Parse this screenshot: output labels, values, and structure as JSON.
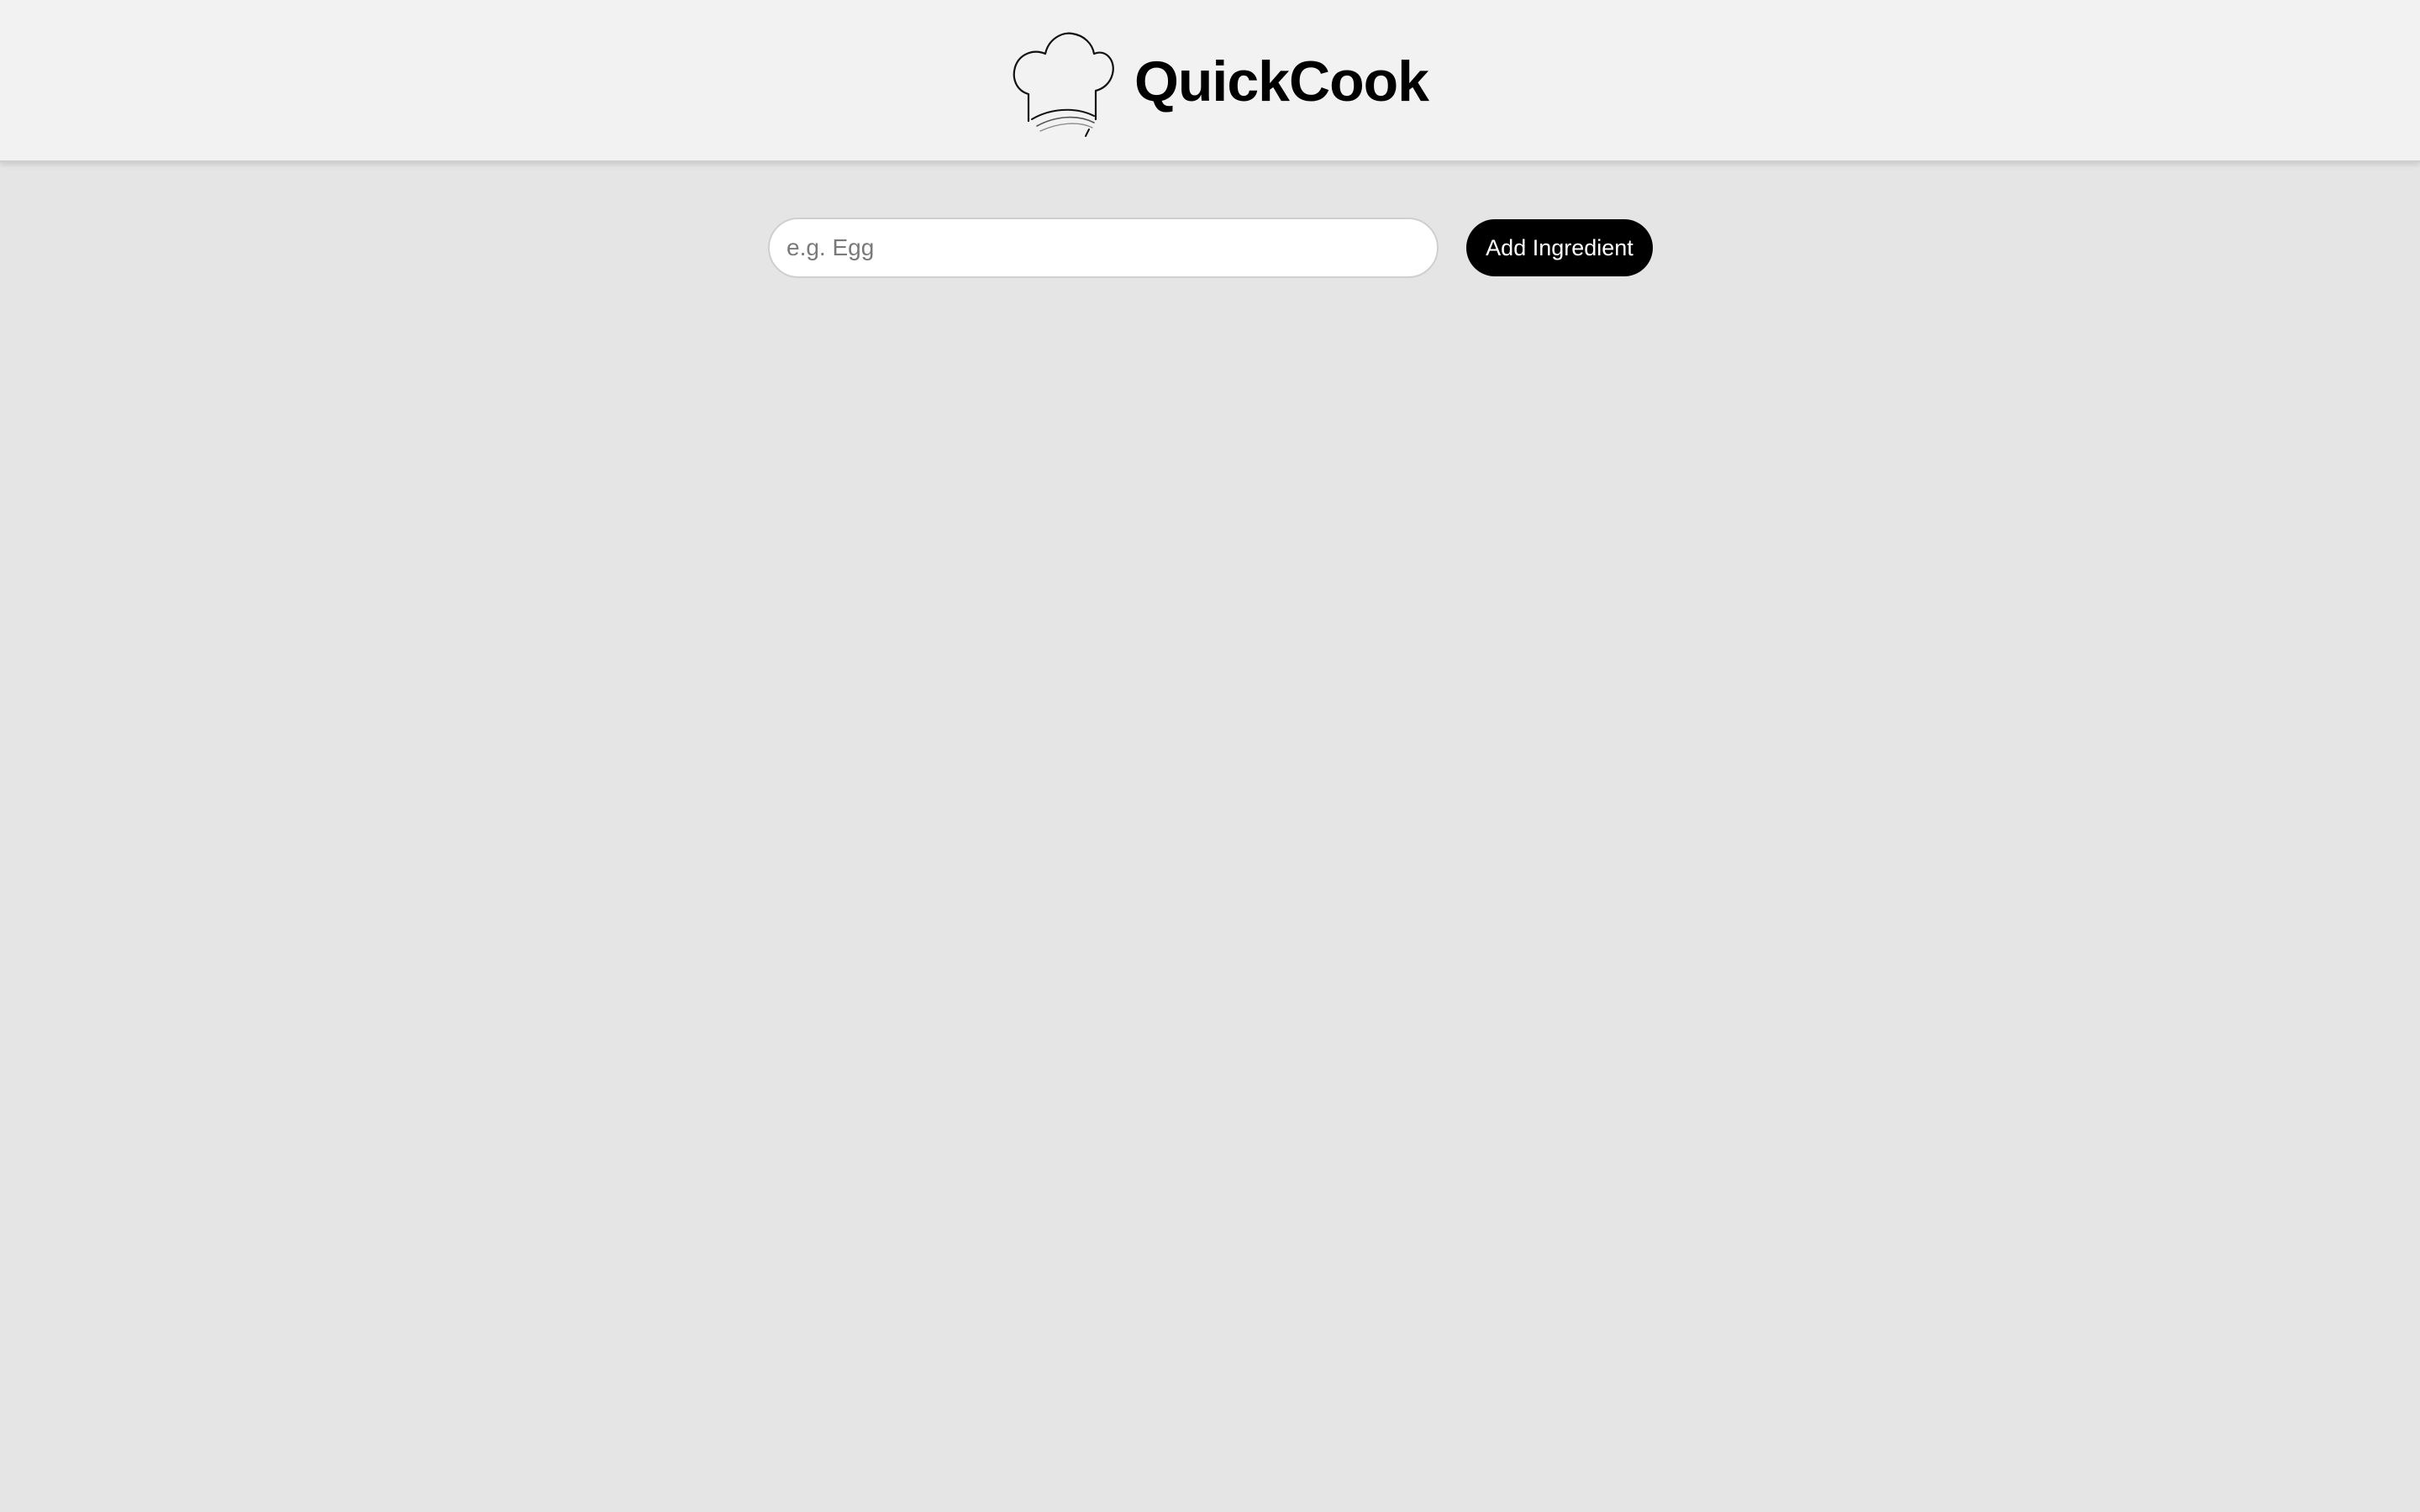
{
  "header": {
    "title": "QuickCook",
    "logo_icon": "chef-hat-icon",
    "background": "#f2f2f2"
  },
  "ingredient_form": {
    "input_value": "",
    "input_placeholder": "e.g. Egg",
    "add_button_label": "Add Ingredient",
    "button_color": "#000000",
    "button_text_color": "#ffffff"
  },
  "page": {
    "background": "#e5e5e5"
  }
}
